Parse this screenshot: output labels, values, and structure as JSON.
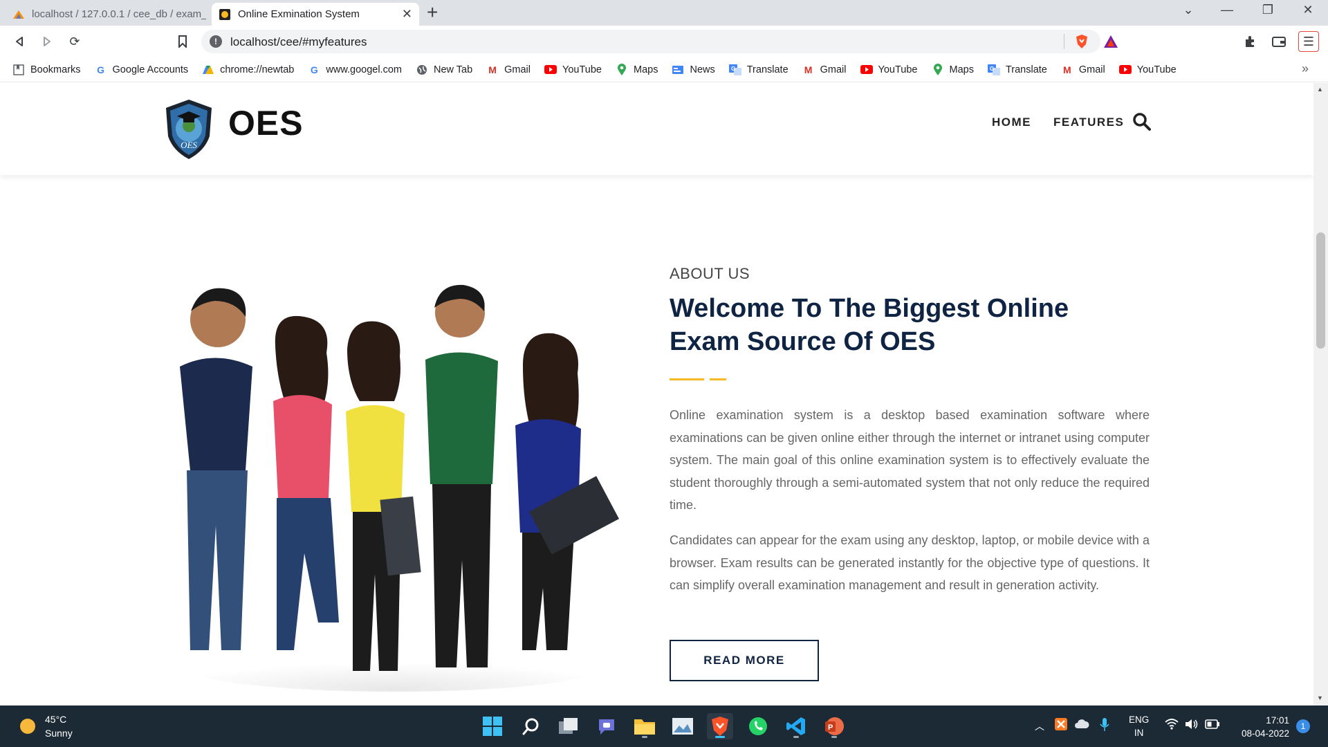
{
  "browser": {
    "tabs": [
      {
        "title": "localhost / 127.0.0.1 / cee_db / exam_",
        "active": false
      },
      {
        "title": "Online Exmination System",
        "active": true
      }
    ],
    "url": "localhost/cee/#myfeatures",
    "bookmarks": [
      {
        "label": "Bookmarks",
        "icon": "bookmarks-icon"
      },
      {
        "label": "Google Accounts",
        "icon": "google-icon"
      },
      {
        "label": "chrome://newtab",
        "icon": "drive-icon"
      },
      {
        "label": "www.googel.com",
        "icon": "google-icon"
      },
      {
        "label": "New Tab",
        "icon": "globe-icon"
      },
      {
        "label": "Gmail",
        "icon": "gmail-icon"
      },
      {
        "label": "YouTube",
        "icon": "youtube-icon"
      },
      {
        "label": "Maps",
        "icon": "maps-icon"
      },
      {
        "label": "News",
        "icon": "news-icon"
      },
      {
        "label": "Translate",
        "icon": "translate-icon"
      },
      {
        "label": "Gmail",
        "icon": "gmail-icon"
      },
      {
        "label": "YouTube",
        "icon": "youtube-icon"
      },
      {
        "label": "Maps",
        "icon": "maps-icon"
      },
      {
        "label": "Translate",
        "icon": "translate-icon"
      },
      {
        "label": "Gmail",
        "icon": "gmail-icon"
      },
      {
        "label": "YouTube",
        "icon": "youtube-icon"
      }
    ],
    "more": "»"
  },
  "site": {
    "logo_text": "OES",
    "logo_badge": "OES",
    "nav": {
      "home": "HOME",
      "features": "FEATURES"
    },
    "about": {
      "kicker": "ABOUT US",
      "headline": "Welcome To The Biggest Online Exam Source Of OES",
      "para1": "Online examination system is a desktop based examination software where examinations can be given online either through the internet or intranet using computer system. The main goal of this online examination system is to effectively evaluate the student thoroughly through a semi-automated system that not only reduce the required time.",
      "para2": "Candidates can appear for the exam using any desktop, laptop, or mobile device with a browser. Exam results can be generated instantly for the objective type of questions. It can simplify overall examination management and result in generation activity.",
      "read_more": "READ MORE"
    },
    "accent_color": "#f7b924",
    "heading_color": "#0f2342"
  },
  "taskbar": {
    "weather_temp": "45°C",
    "weather_desc": "Sunny",
    "lang_1": "ENG",
    "lang_2": "IN",
    "time": "17:01",
    "date": "08-04-2022",
    "notifications": "1"
  }
}
